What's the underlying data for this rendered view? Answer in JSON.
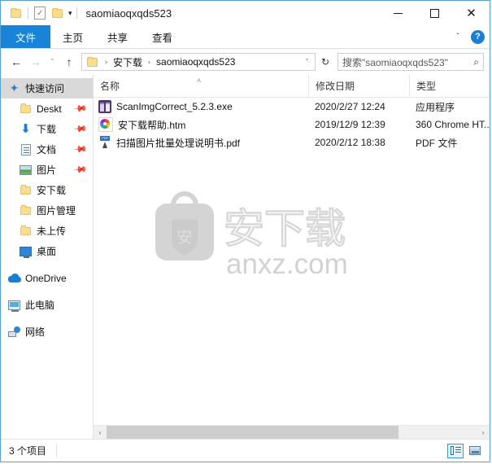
{
  "window": {
    "title": "saomiaoqxqds523",
    "controls": {
      "minimize": "−",
      "maximize": "□",
      "close": "✕"
    },
    "quick_access_toolbar": {
      "folder_icon": "folder-icon",
      "properties_icon": "properties-icon",
      "new_folder_icon": "new-folder-icon",
      "customize_caret": "▾"
    }
  },
  "ribbon": {
    "tabs": [
      {
        "label": "文件",
        "active": true
      },
      {
        "label": "主页",
        "active": false
      },
      {
        "label": "共享",
        "active": false
      },
      {
        "label": "查看",
        "active": false
      }
    ],
    "expand_caret": "ˇ",
    "help_label": "?"
  },
  "addressbar": {
    "back": "←",
    "forward": "→",
    "recent_caret": "ˇ",
    "up": "↑",
    "folder_icon": "folder-icon",
    "breadcrumbs": [
      "安下载",
      "saomiaoqxqds523"
    ],
    "separator": "›",
    "dropdown_caret": "ˇ",
    "refresh": "↻",
    "search": {
      "placeholder": "搜索\"saomiaoqxqds523\"",
      "value": "",
      "icon": "search-icon"
    }
  },
  "sidebar": {
    "items": [
      {
        "label": "快速访问",
        "icon": "star-icon",
        "selected": true,
        "pinned": false,
        "indent": false
      },
      {
        "label": "Deskt",
        "icon": "folder-icon",
        "selected": false,
        "pinned": true,
        "indent": true
      },
      {
        "label": "下载",
        "icon": "download-icon",
        "selected": false,
        "pinned": true,
        "indent": true
      },
      {
        "label": "文档",
        "icon": "document-icon",
        "selected": false,
        "pinned": true,
        "indent": true
      },
      {
        "label": "图片",
        "icon": "picture-icon",
        "selected": false,
        "pinned": true,
        "indent": true
      },
      {
        "label": "安下载",
        "icon": "folder-icon",
        "selected": false,
        "pinned": false,
        "indent": true
      },
      {
        "label": "图片管理",
        "icon": "folder-icon",
        "selected": false,
        "pinned": false,
        "indent": true
      },
      {
        "label": "未上传",
        "icon": "folder-icon",
        "selected": false,
        "pinned": false,
        "indent": true
      },
      {
        "label": "桌面",
        "icon": "desktop-icon",
        "selected": false,
        "pinned": false,
        "indent": true
      },
      {
        "label": "OneDrive",
        "icon": "onedrive-icon",
        "selected": false,
        "pinned": false,
        "indent": false
      },
      {
        "label": "此电脑",
        "icon": "this-pc-icon",
        "selected": false,
        "pinned": false,
        "indent": false
      },
      {
        "label": "网络",
        "icon": "network-icon",
        "selected": false,
        "pinned": false,
        "indent": false
      }
    ],
    "pin_glyph": "📌"
  },
  "filelist": {
    "columns": [
      {
        "label": "名称"
      },
      {
        "label": "修改日期"
      },
      {
        "label": "类型"
      }
    ],
    "sort_indicator": "˄",
    "rows": [
      {
        "name": "ScanImgCorrect_5.2.3.exe",
        "date": "2020/2/27 12:24",
        "type": "应用程序",
        "icon": "exe-file-icon"
      },
      {
        "name": "安下载帮助.htm",
        "date": "2019/12/9 12:39",
        "type": "360 Chrome HT...",
        "icon": "htm-file-icon"
      },
      {
        "name": "扫描图片批量处理说明书.pdf",
        "date": "2020/2/12 18:38",
        "type": "PDF 文件",
        "icon": "pdf-file-icon"
      }
    ]
  },
  "watermark": {
    "logo_text": "安",
    "brand_text": "安下载",
    "domain_text": "anxz.com",
    "color": "#d2d2d2"
  },
  "scrollbar": {
    "left_arrow": "‹",
    "right_arrow": "›"
  },
  "statusbar": {
    "item_count": "3 个项目",
    "views": [
      {
        "name": "details-view",
        "active": true
      },
      {
        "name": "large-icons-view",
        "active": false
      }
    ]
  },
  "colors": {
    "accent": "#1883d7",
    "window_border": "#5a9fd4",
    "folder_yellow": "#fcdd8d",
    "selection_gray": "#d9d9d9"
  }
}
